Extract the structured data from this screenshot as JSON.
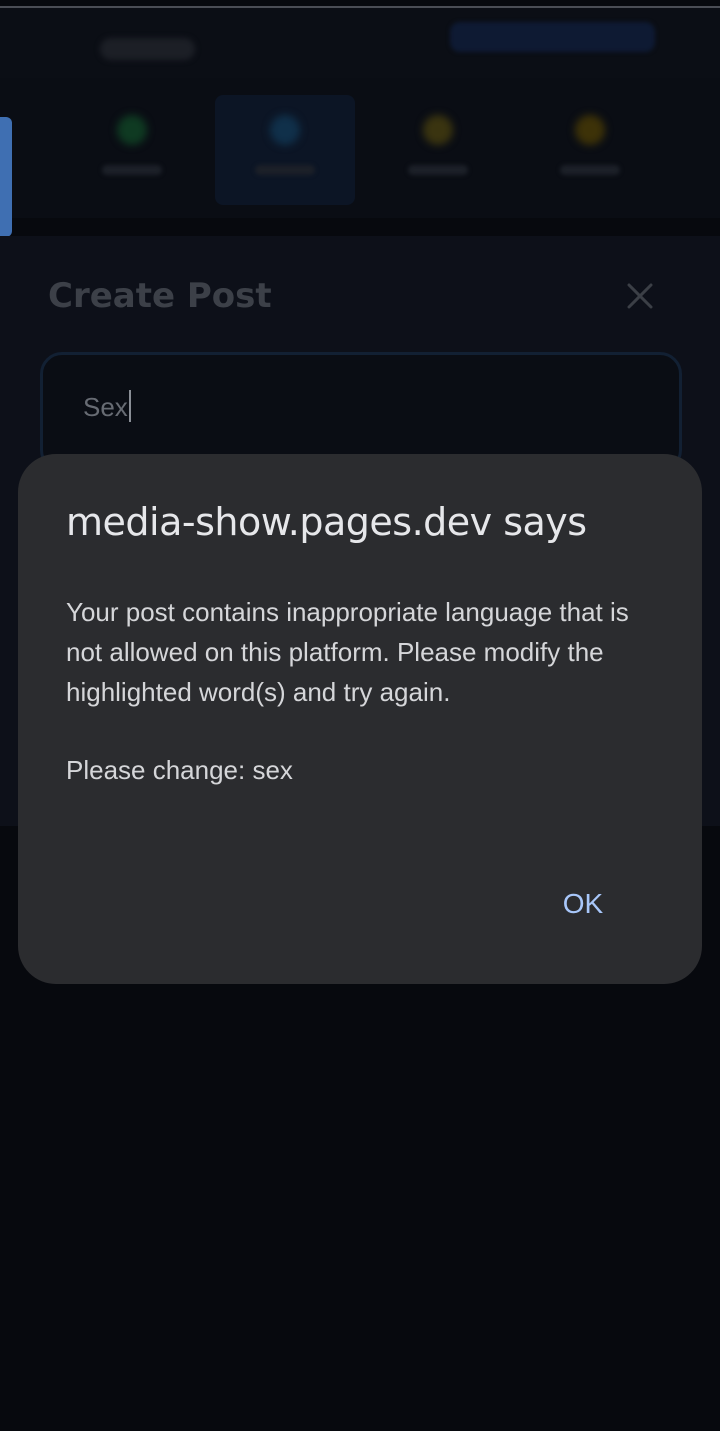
{
  "colors": {
    "background": "#07090e",
    "dialog_background": "#2b2c2f",
    "dialog_text": "#d5d6d9",
    "ok_accent": "#a8c7fa",
    "side_tab": "#3f6fb2"
  },
  "background_app": {
    "create_post": {
      "title": "Create Post",
      "close_icon": "close-icon",
      "input_value": "Sex"
    }
  },
  "dialog": {
    "title": "media-show.pages.dev says",
    "message": "Your post contains inappropriate language that is not allowed on this platform. Please modify the highlighted word(s) and try again.",
    "change_line": "Please change: sex",
    "ok_label": "OK"
  }
}
